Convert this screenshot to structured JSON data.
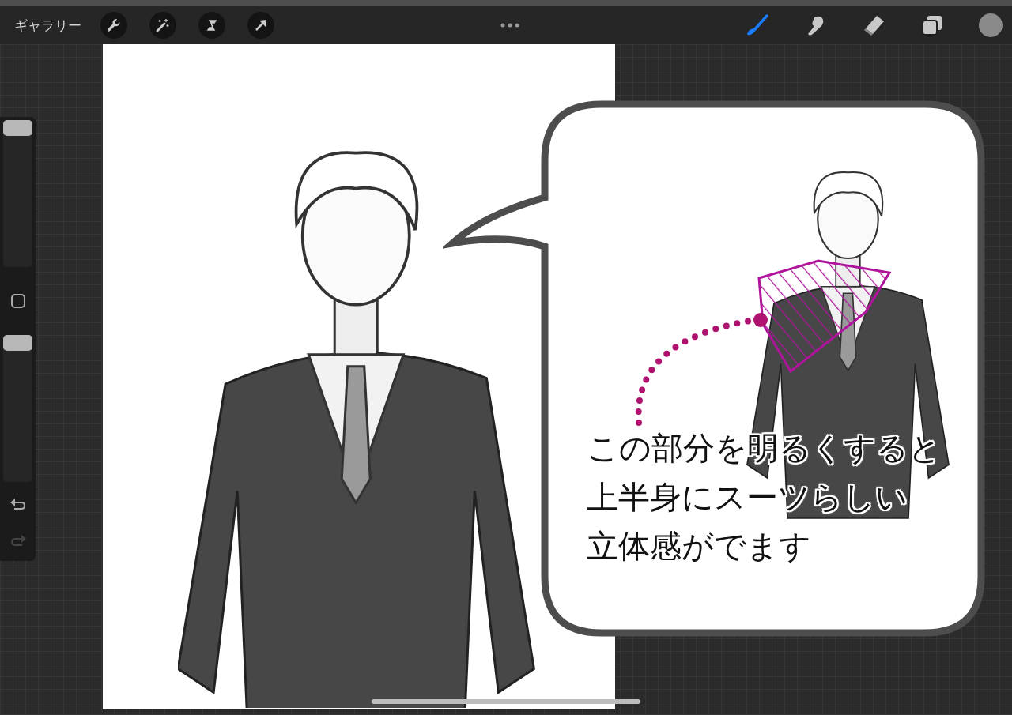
{
  "toolbar": {
    "gallery_label": "ギャラリー",
    "actions": [
      {
        "kind": "wrench"
      },
      {
        "kind": "wand"
      },
      {
        "kind": "select"
      },
      {
        "kind": "transform"
      }
    ],
    "tools": [
      {
        "kind": "brush",
        "selected": true
      },
      {
        "kind": "smudge",
        "selected": false
      },
      {
        "kind": "eraser",
        "selected": false
      },
      {
        "kind": "layers",
        "selected": false
      }
    ]
  },
  "sidebar": {
    "brush_size": {
      "level": 1
    },
    "opacity": {
      "level": 1
    },
    "undo": {
      "disabled": false
    },
    "redo": {
      "disabled": true
    }
  },
  "callout": {
    "lines": [
      "この部分を明るくすると",
      "上半身にスーツらしい",
      "立体感がでます"
    ]
  }
}
